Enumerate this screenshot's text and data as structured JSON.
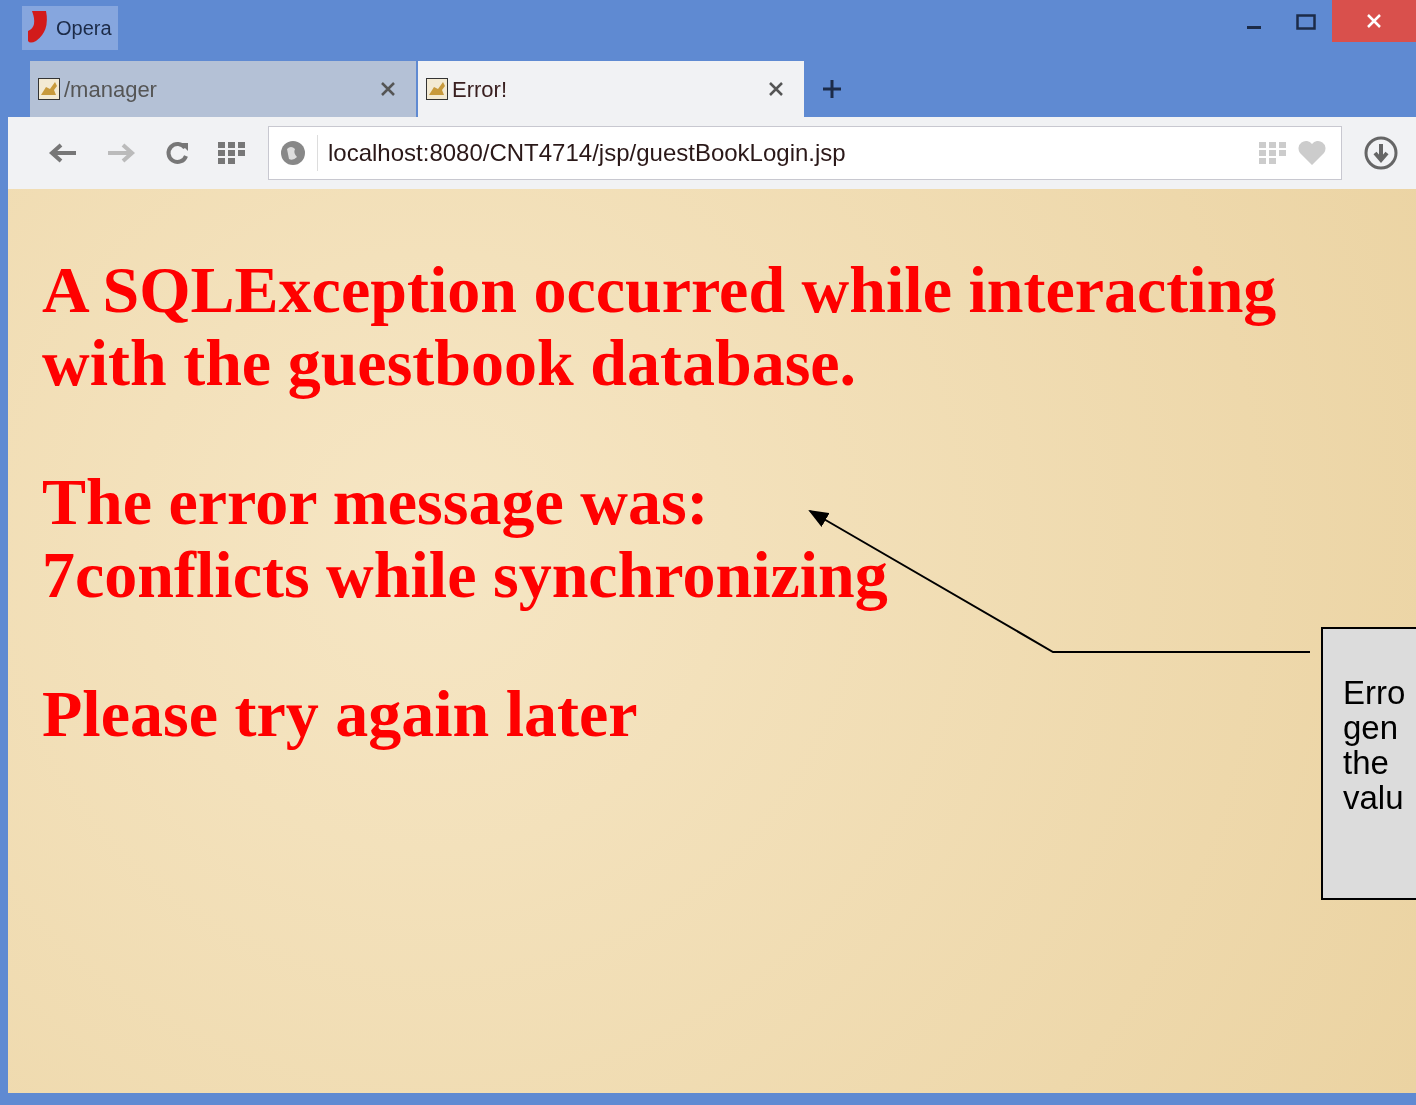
{
  "window": {
    "title": "Opera"
  },
  "tabs": [
    {
      "label": "/manager",
      "selected": false
    },
    {
      "label": "Error!",
      "selected": true
    }
  ],
  "address_bar": {
    "url": "localhost:8080/CNT4714/jsp/guestBookLogin.jsp"
  },
  "page": {
    "paragraphs": [
      [
        "A SQLException occurred while interacting with the guestbook database."
      ],
      [
        "The error message was:",
        "7conflicts while synchronizing"
      ],
      [
        "Please try again later"
      ]
    ]
  },
  "callout": {
    "lines": [
      "Erro",
      "gen",
      "the",
      "valu"
    ]
  }
}
